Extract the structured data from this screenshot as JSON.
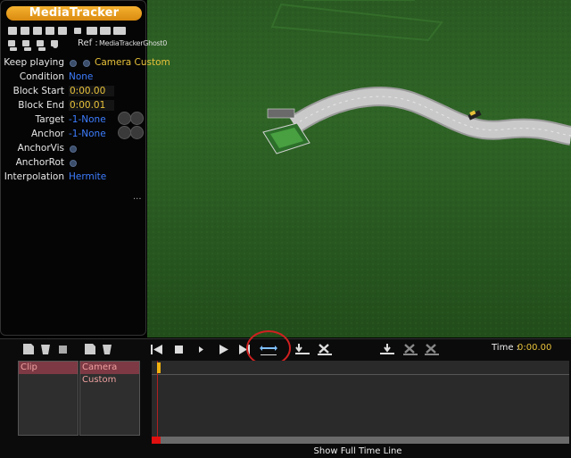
{
  "panel": {
    "title": "MediaTracker",
    "ref_label": "Ref :",
    "ref_value": "MediaTrackerGhost0"
  },
  "properties": [
    {
      "label": "Keep playing",
      "value": "Camera Custom"
    },
    {
      "label": "Condition",
      "value": "None"
    },
    {
      "label": "Block Start",
      "value": "0:00.00"
    },
    {
      "label": "Block End",
      "value": "0:00.01"
    },
    {
      "label": "Target",
      "value": "-1-None"
    },
    {
      "label": "Anchor",
      "value": "-1-None"
    },
    {
      "label": "AnchorVis",
      "value": ""
    },
    {
      "label": "AnchorRot",
      "value": ""
    },
    {
      "label": "Interpolation",
      "value": "Hermite"
    }
  ],
  "more": "...",
  "tracks": [
    {
      "label": "Clip"
    },
    {
      "label": "Camera Custom"
    }
  ],
  "timeline": {
    "time_label": "Time :",
    "time_value": "0:00.00",
    "show_full": "Show Full Time Line",
    "cursor_position": 0
  },
  "icons": {
    "track_add": "track-add-icon",
    "track_cup": "track-cup-icon",
    "rewind": "skip-start-icon",
    "stop": "stop-icon",
    "step": "step-forward-icon",
    "play": "play-icon",
    "end": "skip-end-icon",
    "fit": "fit-timeline-icon",
    "import": "import-icon",
    "delete": "delete-icon"
  },
  "colors": {
    "title_orange": "#e99a1e",
    "value_blue": "#3d7dff",
    "value_yellow": "#e8c23a",
    "track_head": "#7d3a44",
    "highlight_red": "#d02020"
  }
}
